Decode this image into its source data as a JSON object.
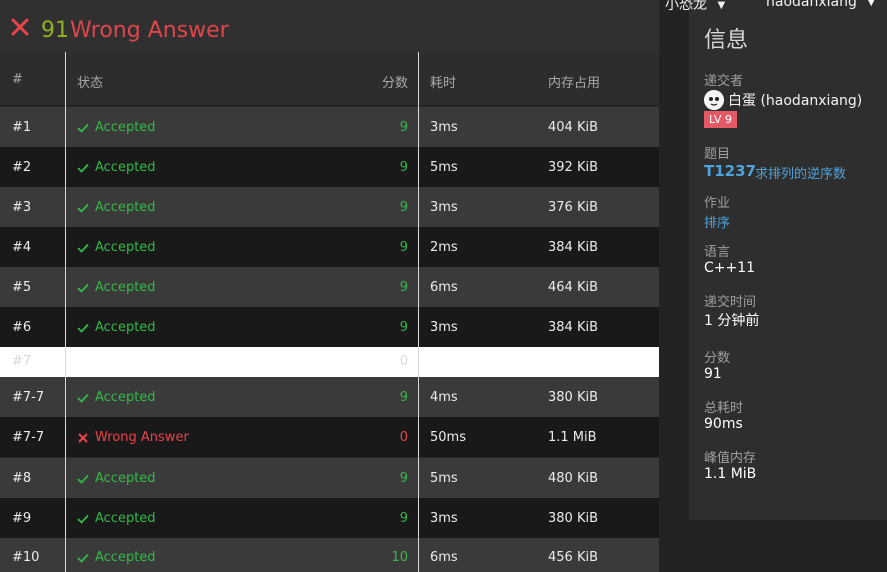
{
  "header": {
    "score": "91",
    "verdict": "Wrong Answer"
  },
  "table": {
    "headers": [
      "#",
      "状态",
      "分数",
      "耗时",
      "内存占用"
    ],
    "rows": [
      {
        "num": "#1",
        "status": "Accepted",
        "score": "9",
        "time": "3ms",
        "memory": "404 KiB"
      },
      {
        "num": "#2",
        "status": "Accepted",
        "score": "9",
        "time": "5ms",
        "memory": "392 KiB"
      },
      {
        "num": "#3",
        "status": "Accepted",
        "score": "9",
        "time": "3ms",
        "memory": "376 KiB"
      },
      {
        "num": "#4",
        "status": "Accepted",
        "score": "9",
        "time": "2ms",
        "memory": "384 KiB"
      },
      {
        "num": "#5",
        "status": "Accepted",
        "score": "9",
        "time": "6ms",
        "memory": "464 KiB"
      },
      {
        "num": "#6",
        "status": "Accepted",
        "score": "9",
        "time": "3ms",
        "memory": "384 KiB"
      },
      {
        "num": "#7",
        "status": "",
        "score": "0",
        "time": "",
        "memory": ""
      },
      {
        "num": "#7-7",
        "status": "Accepted",
        "score": "9",
        "time": "4ms",
        "memory": "380 KiB"
      },
      {
        "num": "#7-7",
        "status": "Wrong Answer",
        "score": "0",
        "time": "50ms",
        "memory": "1.1 MiB"
      },
      {
        "num": "#8",
        "status": "Accepted",
        "score": "9",
        "time": "5ms",
        "memory": "480 KiB"
      },
      {
        "num": "#9",
        "status": "Accepted",
        "score": "9",
        "time": "3ms",
        "memory": "380 KiB"
      },
      {
        "num": "#10",
        "status": "Accepted",
        "score": "10",
        "time": "6ms",
        "memory": "456 KiB"
      }
    ]
  },
  "nav": {
    "left_user": "小恐龙",
    "right_user": "haodanxiang"
  },
  "info": {
    "title": "信息",
    "submitter_label": "递交者",
    "submitter_name": "白蛋 (haodanxiang)",
    "level": "LV 9",
    "problem_label": "题目",
    "problem_id": "T1237",
    "problem_name": "求排列的逆序数",
    "assignment_label": "作业",
    "assignment_value": "排序",
    "language_label": "语言",
    "language_value": "C++11",
    "submit_time_label": "递交时间",
    "submit_time_value": "1 分钟前",
    "score_label": "分数",
    "score_value": "91",
    "total_time_label": "总耗时",
    "total_time_value": "90ms",
    "peak_memory_label": "峰值内存",
    "peak_memory_value": "1.1 MiB"
  },
  "colors": {
    "accepted": "#35b84a",
    "wrong": "#e8444b",
    "link": "#4ea3db",
    "score_header": "#8fb21f"
  }
}
